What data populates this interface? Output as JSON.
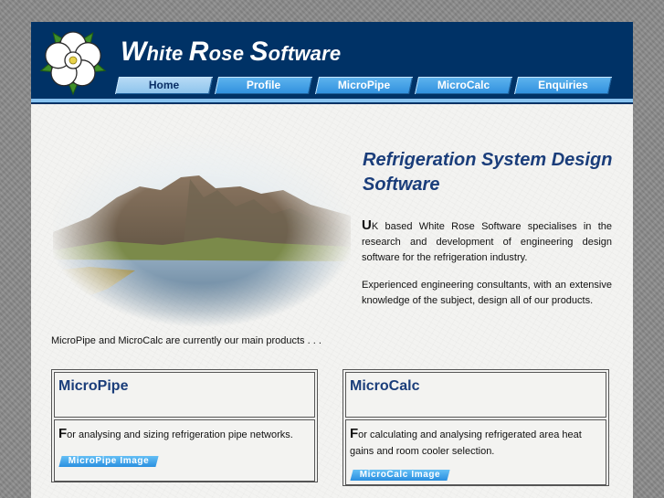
{
  "header": {
    "brand_w": "W",
    "brand_hite": "hite ",
    "brand_r": "R",
    "brand_ose": "ose ",
    "brand_s": "S",
    "brand_oftware": "oftware"
  },
  "nav": {
    "items": [
      {
        "label": "Home"
      },
      {
        "label": "Profile"
      },
      {
        "label": "MicroPipe"
      },
      {
        "label": "MicroCalc"
      },
      {
        "label": "Enquiries"
      }
    ]
  },
  "main": {
    "headline": "Refrigeration System Design Software",
    "para1_drop": "U",
    "para1_rest": "K based White Rose Software specialises in the research and development of engineering design software for the refrigeration industry.",
    "para2": "Experienced engineering consultants, with an extensive knowledge of the subject, design all of our products.",
    "intro": "MicroPipe and MicroCalc are currently our main products . . ."
  },
  "cards": [
    {
      "title": "MicroPipe",
      "drop": "F",
      "text": "or analysing and sizing refrigeration pipe networks.",
      "link": "MicroPipe Image"
    },
    {
      "title": "MicroCalc",
      "drop": "F",
      "text": "or calculating and analysing refrigerated area heat gains and room cooler selection.",
      "link": "MicroCalc Image"
    }
  ],
  "colors": {
    "header_bg": "#003266",
    "accent": "#88c2ef",
    "nav_button": "#3b9ae3",
    "headline": "#1a3d7a"
  },
  "icons": {
    "logo": "white-rose-icon"
  }
}
